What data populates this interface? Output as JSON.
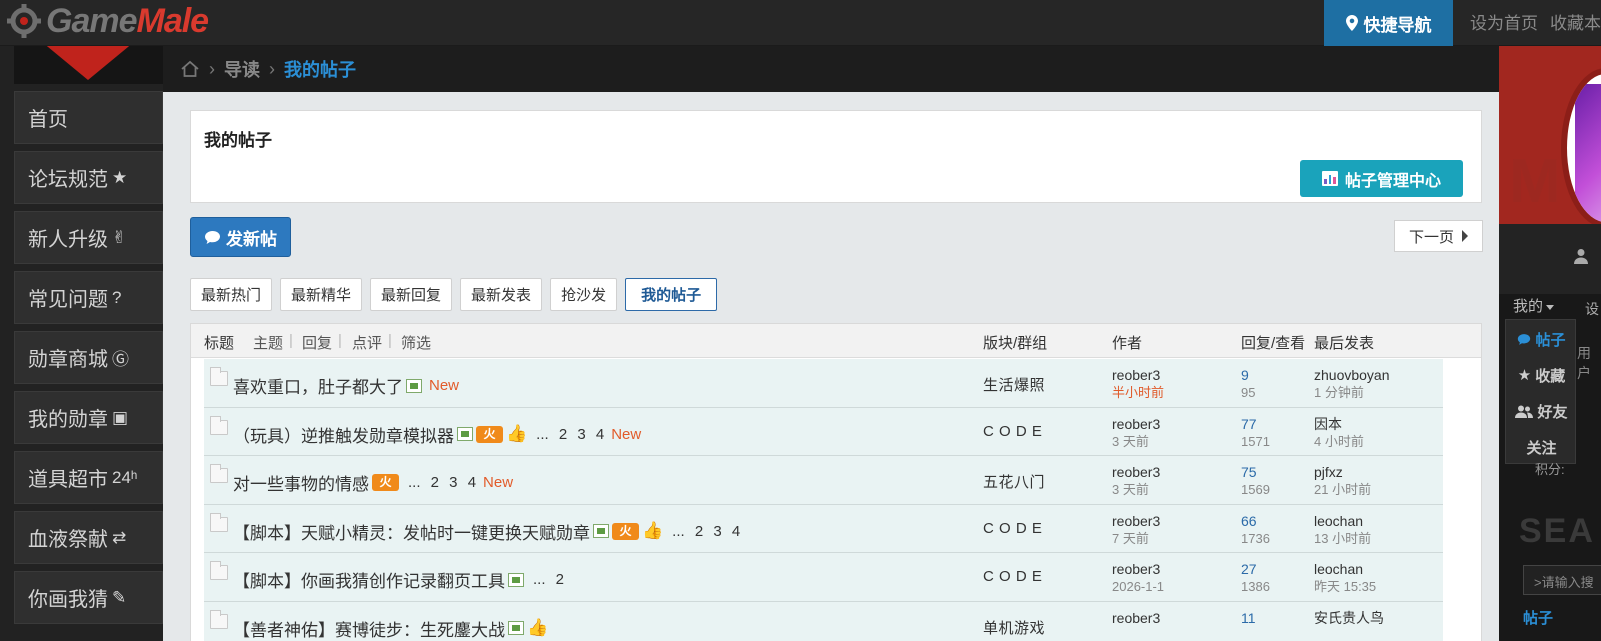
{
  "header": {
    "logo_part1": "Game",
    "logo_part2": "Male",
    "quick_nav": "快捷导航",
    "links": [
      "设为首页",
      "收藏本"
    ]
  },
  "sidebar": {
    "items": [
      {
        "label": "首页",
        "icon": ""
      },
      {
        "label": "论坛规范",
        "icon": "★"
      },
      {
        "label": "新人升级",
        "icon": "✌"
      },
      {
        "label": "常见问题",
        "icon": "?"
      },
      {
        "label": "勋章商城",
        "icon": "Ⓖ"
      },
      {
        "label": "我的勋章",
        "icon": "▣"
      },
      {
        "label": "道具超市",
        "icon": "24ʰ"
      },
      {
        "label": "血液祭献",
        "icon": "⇄"
      },
      {
        "label": "你画我猜",
        "icon": "✎"
      }
    ]
  },
  "breadcrumb": {
    "items": [
      "导读",
      "我的帖子"
    ]
  },
  "page": {
    "title": "我的帖子",
    "manage_button": "帖子管理中心",
    "new_post_button": "发新帖",
    "next_page_button": "下一页"
  },
  "tabs": [
    "最新热门",
    "最新精华",
    "最新回复",
    "最新发表",
    "抢沙发",
    "我的帖子"
  ],
  "table": {
    "headers": {
      "title": "标题",
      "filters": [
        "主题",
        "回复",
        "点评",
        "筛选"
      ],
      "forum": "版块/群组",
      "author": "作者",
      "replies": "回复/查看",
      "last": "最后发表"
    },
    "rows": [
      {
        "title": "喜欢重口，肚子都大了",
        "img": true,
        "fire": false,
        "thumb": false,
        "pages": "",
        "new": "New",
        "forum": "生活爆照",
        "author": "reober3",
        "time": "半小时前",
        "time_red": true,
        "replies": "9",
        "views": "95",
        "last_user": "zhuovboyan",
        "last_time": "1 分钟前"
      },
      {
        "title": "（玩具）逆推触发勋章模拟器",
        "img": true,
        "fire": true,
        "thumb": true,
        "pages": "... 2 3 4",
        "new": "New",
        "forum": "C O D E",
        "author": "reober3",
        "time": "3 天前",
        "time_red": false,
        "replies": "77",
        "views": "1571",
        "last_user": "因本",
        "last_time": "4 小时前"
      },
      {
        "title": "对一些事物的情感",
        "img": false,
        "fire": true,
        "thumb": false,
        "pages": "... 2 3 4",
        "new": "New",
        "forum": "五花八门",
        "author": "reober3",
        "time": "3 天前",
        "time_red": false,
        "replies": "75",
        "views": "1569",
        "last_user": "pjfxz",
        "last_time": "21 小时前"
      },
      {
        "title": "【脚本】天赋小精灵：发帖时一键更换天赋勋章",
        "img": true,
        "fire": true,
        "thumb": true,
        "pages": "... 2 3 4",
        "new": "",
        "forum": "C O D E",
        "author": "reober3",
        "time": "7 天前",
        "time_red": false,
        "replies": "66",
        "views": "1736",
        "last_user": "leochan",
        "last_time": "13 小时前"
      },
      {
        "title": "【脚本】你画我猜创作记录翻页工具",
        "img": true,
        "fire": false,
        "thumb": false,
        "pages": "... 2",
        "new": "",
        "forum": "C O D E",
        "author": "reober3",
        "time": "2026-1-1",
        "time_red": false,
        "replies": "27",
        "views": "1386",
        "last_user": "leochan",
        "last_time": "昨天 15:35"
      },
      {
        "title": "【善者神佑】赛博徒步：生死鏖大战",
        "img": true,
        "fire": false,
        "thumb": true,
        "pages": "",
        "new": "",
        "forum": "单机游戏",
        "author": "reober3",
        "time": "",
        "time_red": false,
        "replies": "11",
        "views": "",
        "last_user": "安氏贵人鸟",
        "last_time": ""
      }
    ]
  },
  "right_panel": {
    "mine_label": "我的",
    "side_label": "设",
    "side_label2": "用户",
    "dropdown": [
      "帖子",
      "收藏",
      "好友",
      "关注"
    ],
    "points": "积分:",
    "search_heading": "SEA",
    "search_placeholder": ">请输入搜",
    "bottom_tab": "帖子"
  },
  "colors": {
    "accent_blue": "#1e6fa3",
    "teal_button": "#1aa3bb",
    "new_red": "#e25b2a",
    "logo_red": "#d93a2e"
  }
}
